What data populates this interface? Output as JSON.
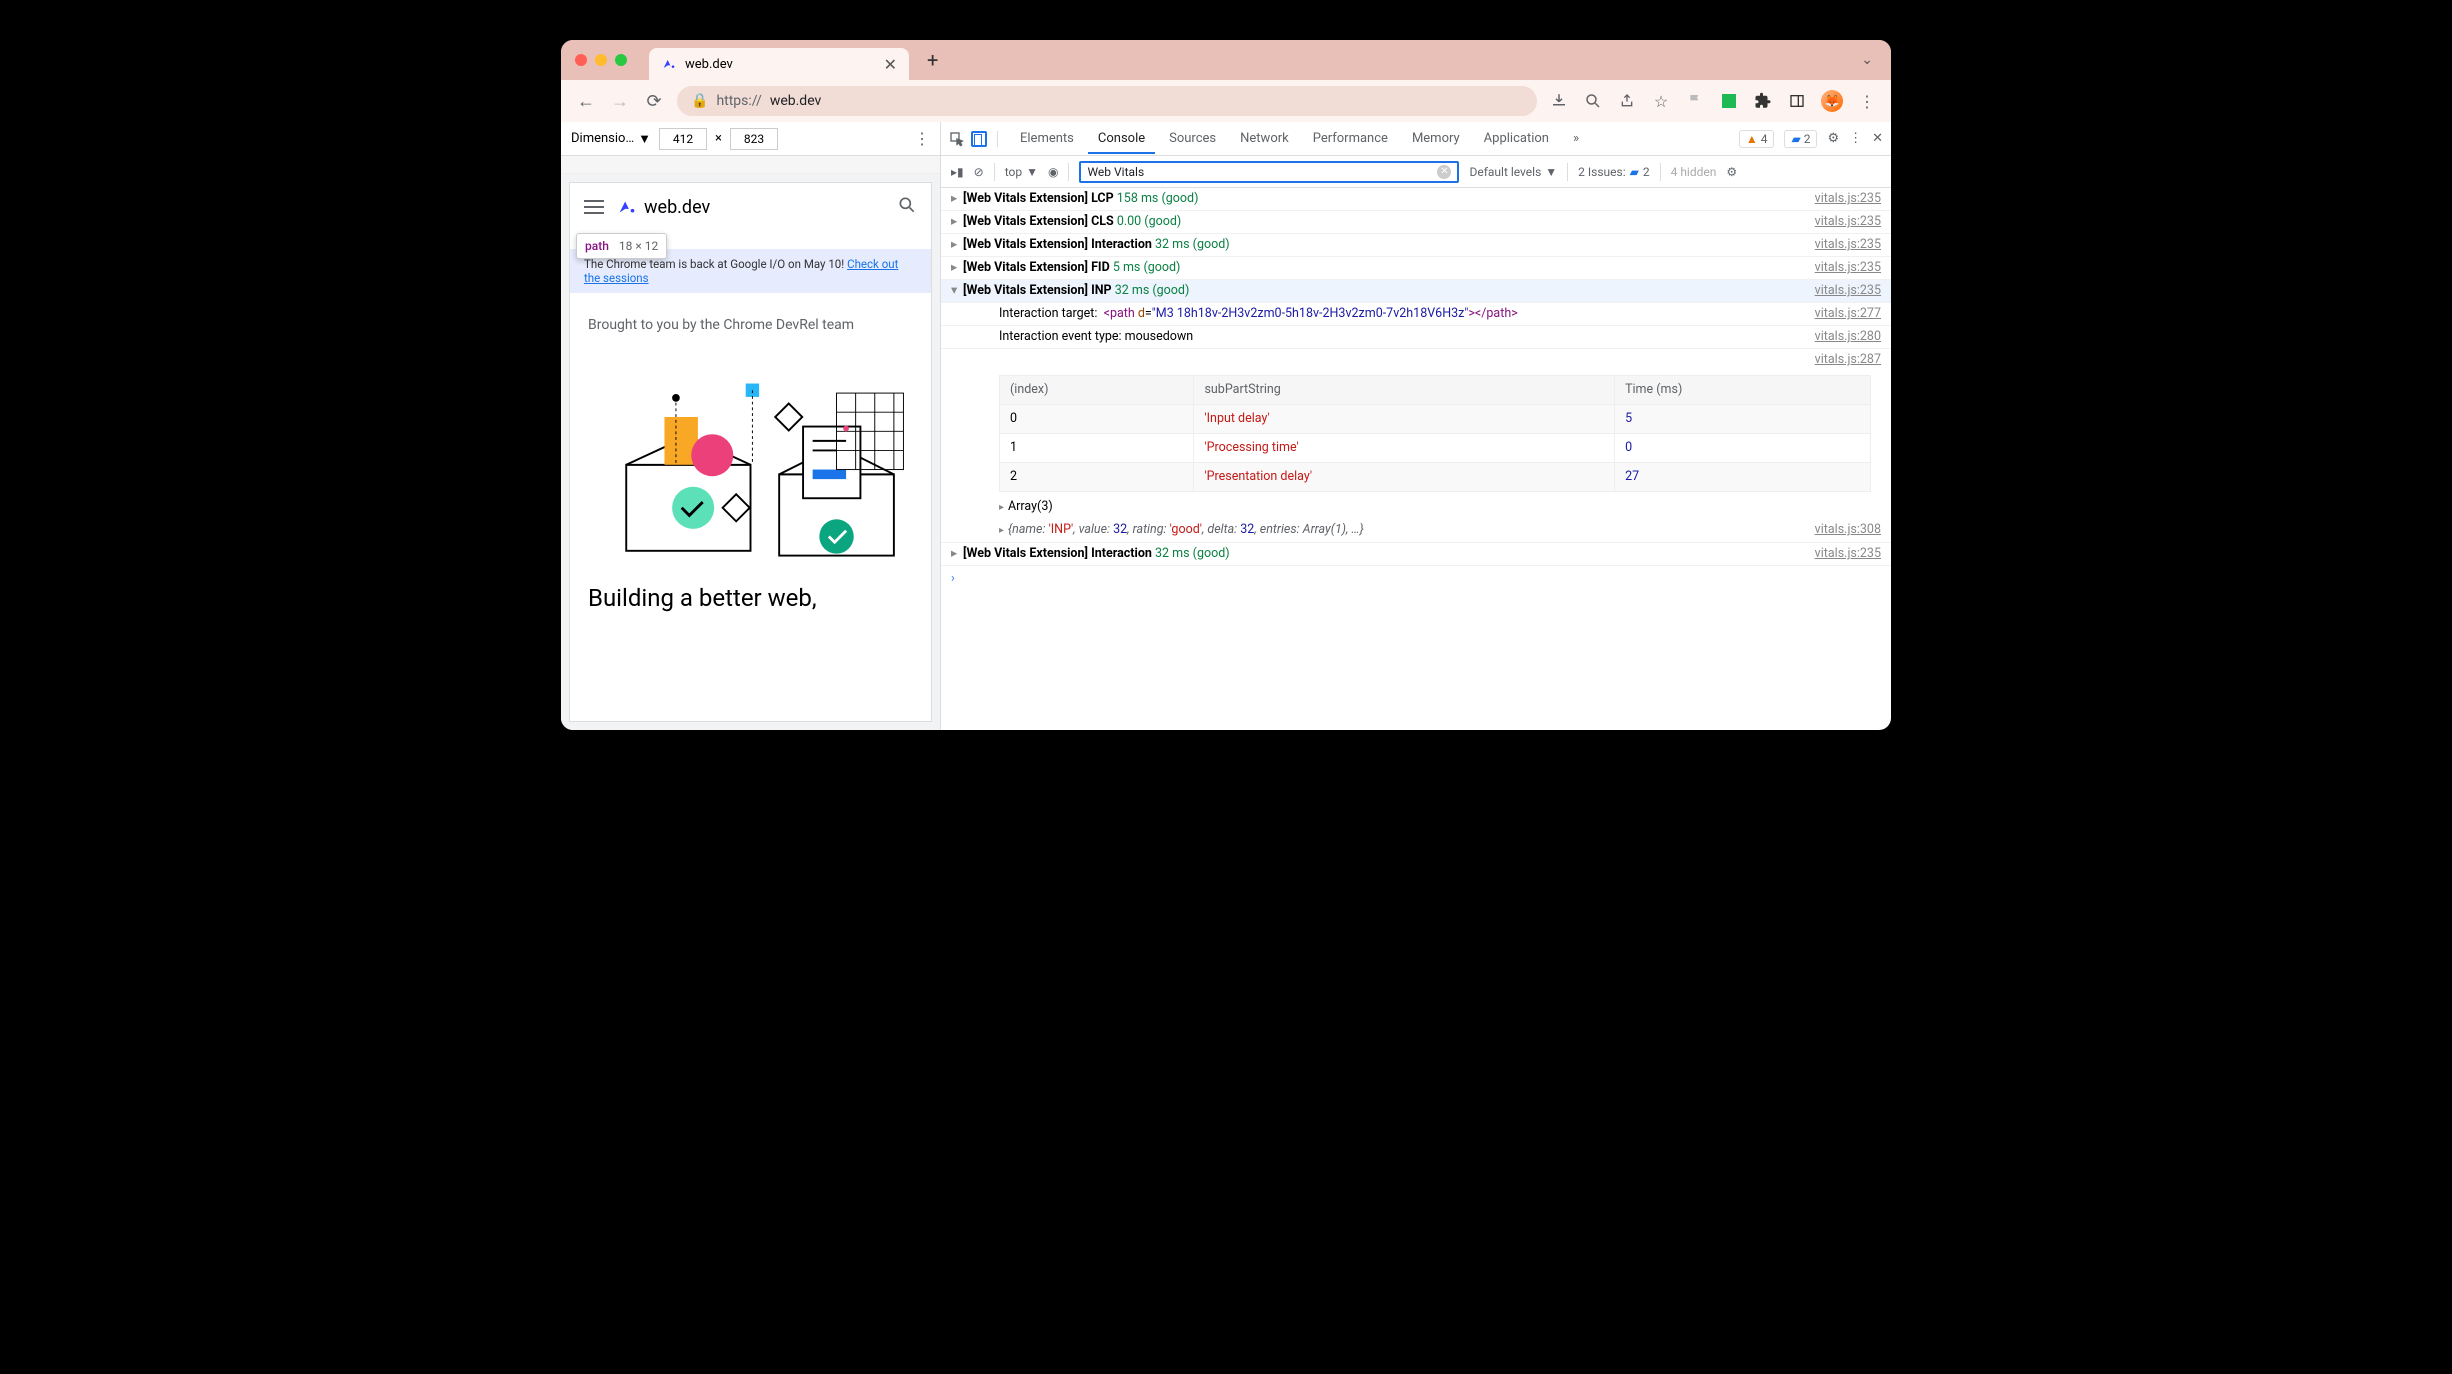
{
  "browser": {
    "tab_title": "web.dev",
    "url_prefix": "https://",
    "url_host": "web.dev"
  },
  "device_toolbar": {
    "label": "Dimensio…",
    "width": "412",
    "times": "×",
    "height": "823"
  },
  "tooltip": {
    "tag": "path",
    "size": "18 × 12"
  },
  "page": {
    "logo_text": "web.dev",
    "banner_text": "The Chrome team is back at Google I/O on May 10! ",
    "banner_link": "Check out the sessions",
    "byline": "Brought to you by the Chrome DevRel team",
    "hero": "Building a better web,"
  },
  "devtools": {
    "tabs": [
      "Elements",
      "Console",
      "Sources",
      "Network",
      "Performance",
      "Memory",
      "Application"
    ],
    "active_tab": "Console",
    "warnings": "4",
    "info": "2",
    "context": "top",
    "filter": "Web Vitals",
    "levels": "Default levels",
    "issues_label": "2 Issues:",
    "issues_count": "2",
    "hidden": "4 hidden"
  },
  "logs": [
    {
      "open": false,
      "prefix": "[Web Vitals Extension] LCP ",
      "val": "158 ms (good)",
      "src": "vitals.js:235"
    },
    {
      "open": false,
      "prefix": "[Web Vitals Extension] CLS ",
      "val": "0.00 (good)",
      "src": "vitals.js:235"
    },
    {
      "open": false,
      "prefix": "[Web Vitals Extension] Interaction ",
      "val": "32 ms (good)",
      "src": "vitals.js:235"
    },
    {
      "open": false,
      "prefix": "[Web Vitals Extension] FID ",
      "val": "5 ms (good)",
      "src": "vitals.js:235"
    },
    {
      "open": true,
      "hov": true,
      "prefix": "[Web Vitals Extension] INP ",
      "val": "32 ms (good)",
      "src": "vitals.js:235"
    }
  ],
  "inp_details": {
    "target_label": "Interaction target:  ",
    "target_tag": "<path ",
    "target_attr": "d",
    "target_eq": "=",
    "target_val": "\"M3 18h18v-2H3v2zm0-5h18v-2H3v2zm0-7v2h18V6H3z\"",
    "target_close": "></path>",
    "target_src": "vitals.js:277",
    "event_label": "Interaction event type: ",
    "event_val": "mousedown",
    "event_src": "vitals.js:280",
    "table_src": "vitals.js:287",
    "headers": [
      "(index)",
      "subPartString",
      "Time (ms)"
    ],
    "rows": [
      {
        "i": "0",
        "s": "'Input delay'",
        "t": "5"
      },
      {
        "i": "1",
        "s": "'Processing time'",
        "t": "0"
      },
      {
        "i": "2",
        "s": "'Presentation delay'",
        "t": "27"
      }
    ],
    "array_label": "Array(3)",
    "obj": "{name: 'INP', value: 32, rating: 'good', delta: 32, entries: Array(1), …}",
    "obj_src": "vitals.js:308"
  },
  "log_after": {
    "prefix": "[Web Vitals Extension] Interaction ",
    "val": "32 ms (good)",
    "src": "vitals.js:235"
  }
}
